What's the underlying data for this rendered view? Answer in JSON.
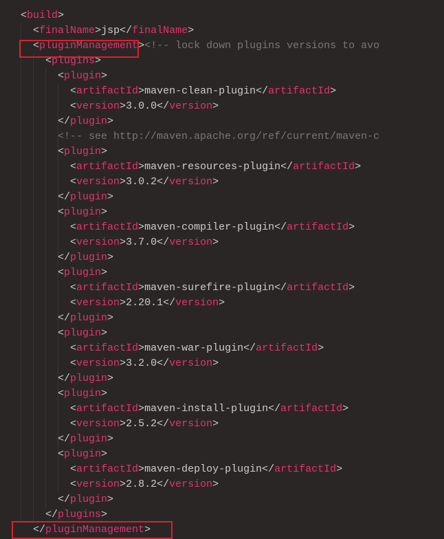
{
  "code": {
    "build": "build",
    "finalName": "finalName",
    "finalNameValue": "jsp",
    "pluginManagement": "pluginManagement",
    "plugins": "plugins",
    "plugin": "plugin",
    "artifactId": "artifactId",
    "version": "version",
    "commentLock": "<!-- lock down plugins versions to avo",
    "commentSee": "<!-- see http://maven.apache.org/ref/current/maven-c",
    "items": [
      {
        "artifact": "maven-clean-plugin",
        "ver": "3.0.0"
      },
      {
        "artifact": "maven-resources-plugin",
        "ver": "3.0.2"
      },
      {
        "artifact": "maven-compiler-plugin",
        "ver": "3.7.0"
      },
      {
        "artifact": "maven-surefire-plugin",
        "ver": "2.20.1"
      },
      {
        "artifact": "maven-war-plugin",
        "ver": "3.2.0"
      },
      {
        "artifact": "maven-install-plugin",
        "ver": "2.5.2"
      },
      {
        "artifact": "maven-deploy-plugin",
        "ver": "2.8.2"
      }
    ]
  }
}
